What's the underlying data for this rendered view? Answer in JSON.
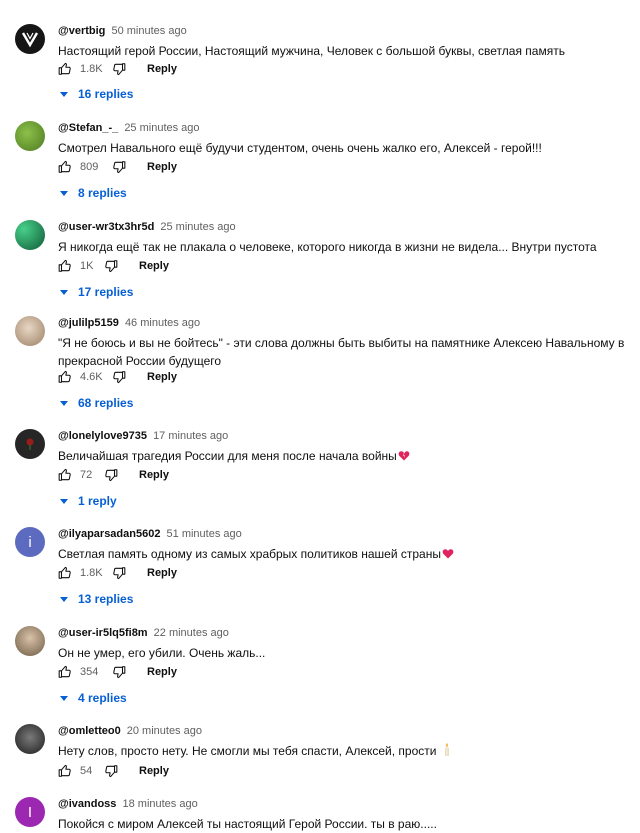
{
  "comments": [
    {
      "author": "@vertbig",
      "time": "50 minutes ago",
      "text": "Настоящий герой России, Настоящий мужчина, Человек с большой буквы, светлая память",
      "likes": "1.8K",
      "reply_label": "Reply",
      "replies": "16 replies",
      "avatar": {
        "kind": "logo",
        "bg": "#161616"
      }
    },
    {
      "author": "@Stefan_-_",
      "time": "25 minutes ago",
      "text": "Смотрел Навального ещё будучи студентом, очень очень жалко его, Алексей - герой!!!",
      "likes": "809",
      "reply_label": "Reply",
      "replies": "8 replies",
      "avatar": {
        "kind": "photo",
        "bg": "#5f8e2a"
      }
    },
    {
      "author": "@user-wr3tx3hr5d",
      "time": "25 minutes ago",
      "text": "Я никогда ещё так не плакала о человеке, которого никогда в жизни не видела... Внутри пустота",
      "likes": "1K",
      "reply_label": "Reply",
      "replies": "17 replies",
      "avatar": {
        "kind": "photo",
        "bg": "#1e7a4e"
      }
    },
    {
      "author": "@julilp5159",
      "time": "46 minutes ago",
      "text": "\"Я не боюсь и вы не бойтесь\" - эти слова должны быть выбиты на памятнике Алексею Навальному в прекрасной России будущего",
      "likes": "4.6K",
      "reply_label": "Reply",
      "replies": "68 replies",
      "avatar": {
        "kind": "photo",
        "bg": "#c9b39a"
      }
    },
    {
      "author": "@lonelylove9735",
      "time": "17 minutes ago",
      "text": "Величайшая трагедия России для меня после начала войны",
      "emoji": "broken-heart",
      "likes": "72",
      "reply_label": "Reply",
      "replies": "1 reply",
      "avatar": {
        "kind": "photo",
        "bg": "#2a2a2a"
      }
    },
    {
      "author": "@ilyaparsadan5602",
      "time": "51 minutes ago",
      "text": "Светлая память одному из самых храбрых политиков нашей страны",
      "emoji": "heart",
      "likes": "1.8K",
      "reply_label": "Reply",
      "replies": "13 replies",
      "avatar": {
        "kind": "letter",
        "letter": "i",
        "bg": "#5c6bc0"
      }
    },
    {
      "author": "@user-ir5lq5fi8m",
      "time": "22 minutes ago",
      "text": "Он не умер, его убили. Очень жаль...",
      "likes": "354",
      "reply_label": "Reply",
      "replies": "4 replies",
      "avatar": {
        "kind": "photo",
        "bg": "#a08a70"
      }
    },
    {
      "author": "@omletteo0",
      "time": "20 minutes ago",
      "text": "Нету слов, просто нету. Не смогли мы тебя спасти, Алексей, прости",
      "emoji": "candle",
      "likes": "54",
      "reply_label": "Reply",
      "avatar": {
        "kind": "photo",
        "bg": "#3a3a3a"
      }
    },
    {
      "author": "@ivandoss",
      "time": "18 minutes ago",
      "text": "Покойся с миром Алексей ты настоящий Герой России. ты в раю.....",
      "avatar": {
        "kind": "letter",
        "letter": "I",
        "bg": "#9c27b0"
      }
    }
  ]
}
